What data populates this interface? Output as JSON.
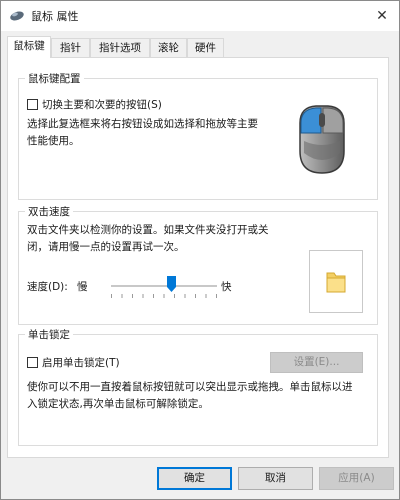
{
  "window": {
    "title": "鼠标 属性",
    "close_glyph": "✕",
    "icon": "mouse-app-icon"
  },
  "tabs": [
    {
      "label": "鼠标键",
      "active": true
    },
    {
      "label": "指针",
      "active": false
    },
    {
      "label": "指针选项",
      "active": false
    },
    {
      "label": "滚轮",
      "active": false
    },
    {
      "label": "硬件",
      "active": false
    }
  ],
  "button_config": {
    "group_label": "鼠标键配置",
    "switch_checkbox_label": "切换主要和次要的按钮(S)",
    "switch_checked": false,
    "description": "选择此复选框来将右按钮设成如选择和拖放等主要\n性能使用。"
  },
  "double_click": {
    "group_label": "双击速度",
    "description": "双击文件夹以检测你的设置。如果文件夹没打开或关\n闭，请用慢一点的设置再试一次。",
    "speed_label": "速度(D):",
    "slow_label": "慢",
    "fast_label": "快",
    "speed_fraction": 0.57,
    "test_icon": "folder-icon"
  },
  "click_lock": {
    "group_label": "单击锁定",
    "checkbox_label": "启用单击锁定(T)",
    "checked": false,
    "settings_button": "设置(E)...",
    "description": "使你可以不用一直按着鼠标按钮就可以突出显示或拖拽。单击鼠标以进\n入锁定状态,再次单击鼠标可解除锁定。"
  },
  "footer": {
    "ok": "确定",
    "cancel": "取消",
    "apply": "应用(A)"
  },
  "colors": {
    "accent": "#0078d7",
    "mouse_highlight": "#3b8fd6"
  }
}
